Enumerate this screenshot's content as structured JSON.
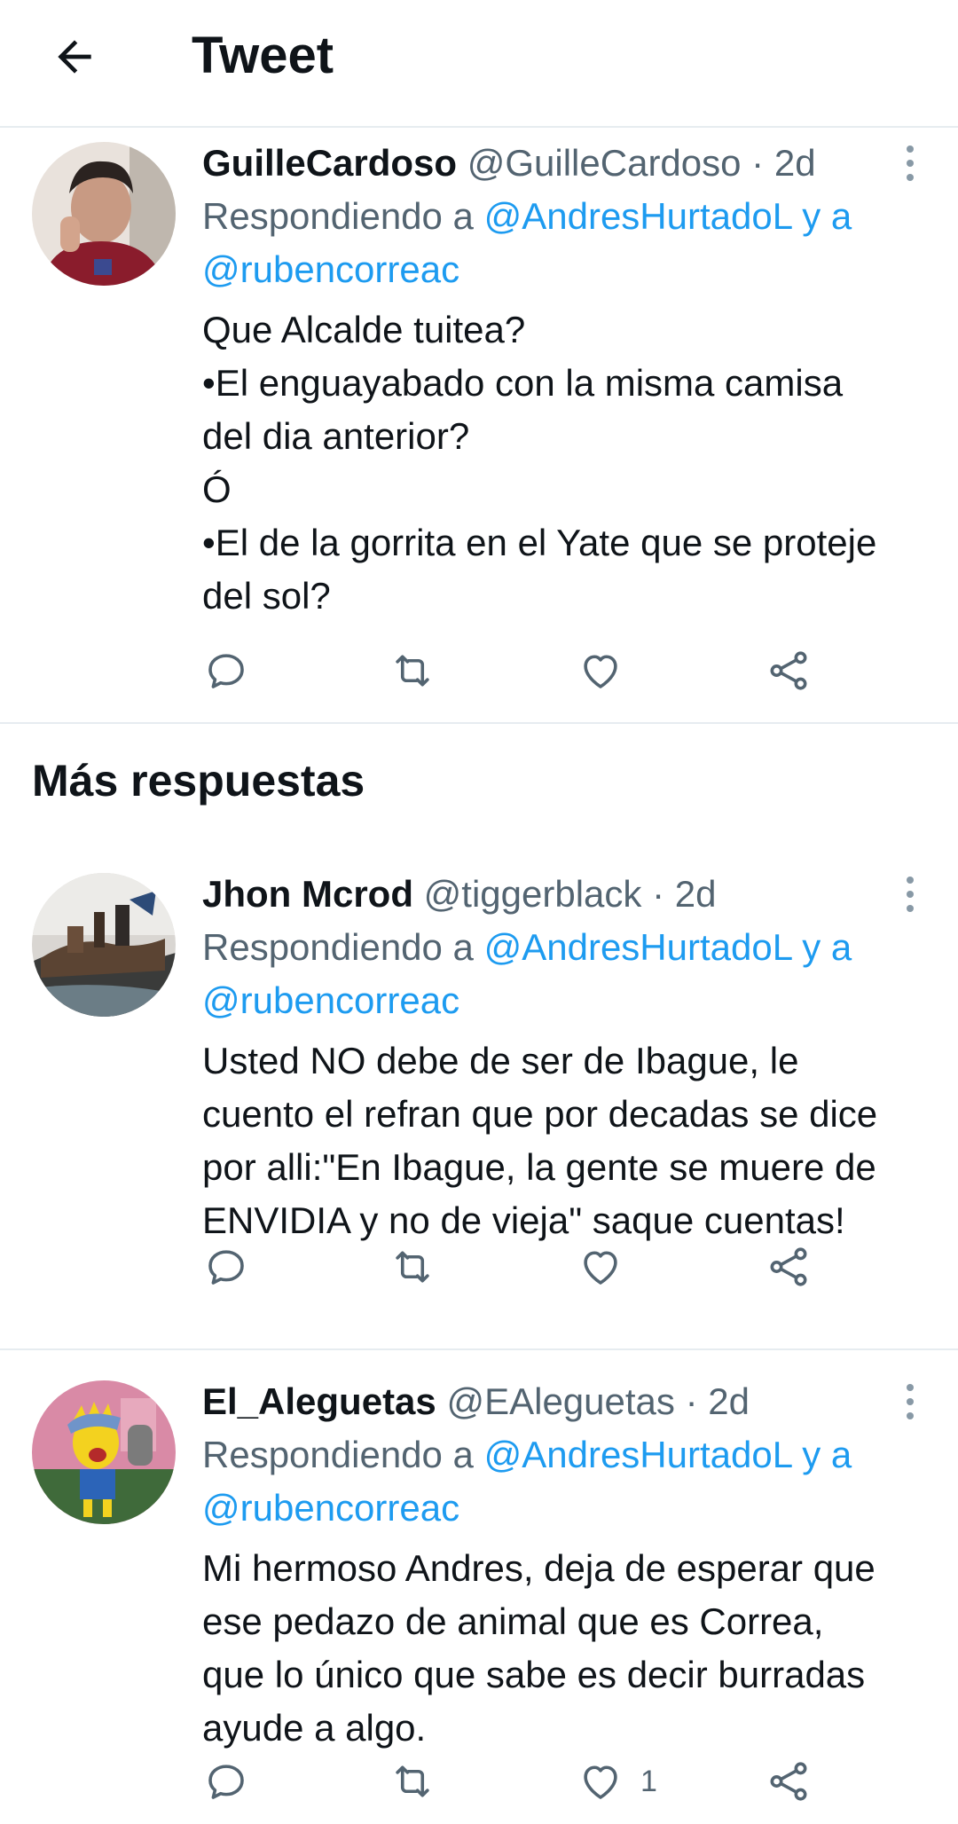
{
  "header": {
    "title": "Tweet"
  },
  "section_title": "Más respuestas",
  "tweets": [
    {
      "name": "GuilleCardoso",
      "handle": "@GuilleCardoso",
      "dot": "·",
      "time": "2d",
      "reply_prefix": "Respondiendo a",
      "mention1": "@AndresHurtadoL",
      "reply_join": "y a",
      "mention2": "@rubencorreac",
      "lines": [
        "Que Alcalde tuitea?",
        "•El enguayabado con la misma camisa",
        "del dia anterior?",
        "Ó",
        "•El de la gorrita en el Yate que se proteje",
        "del sol?"
      ],
      "like_count": ""
    },
    {
      "name": "Jhon Mcrod",
      "handle": "@tiggerblack",
      "dot": "·",
      "time": "2d",
      "reply_prefix": "Respondiendo a",
      "mention1": "@AndresHurtadoL",
      "reply_join": "y a",
      "mention2": "@rubencorreac",
      "lines": [
        "Usted NO debe de ser de Ibague, le",
        "cuento el refran que por decadas se dice",
        "por alli:\"En Ibague, la gente se muere de",
        "ENVIDIA y no de vieja\" saque cuentas!"
      ],
      "like_count": ""
    },
    {
      "name": "El_Aleguetas",
      "handle": "@EAleguetas",
      "dot": "·",
      "time": "2d",
      "reply_prefix": "Respondiendo a",
      "mention1": "@AndresHurtadoL",
      "reply_join": "y a",
      "mention2": "@rubencorreac",
      "lines": [
        "Mi hermoso Andres, deja de esperar que",
        "ese pedazo de animal que es Correa,",
        "que lo único que sabe es decir burradas",
        "ayude a algo."
      ],
      "like_count": "1"
    }
  ],
  "icons": {
    "back": "arrow-left-icon",
    "reply": "reply-icon",
    "retweet": "retweet-icon",
    "like": "heart-icon",
    "share": "share-icon",
    "more": "more-vertical-icon"
  },
  "colors": {
    "link": "#1d9bf0",
    "secondary_text": "#536471",
    "divider": "#e6ecf0"
  }
}
